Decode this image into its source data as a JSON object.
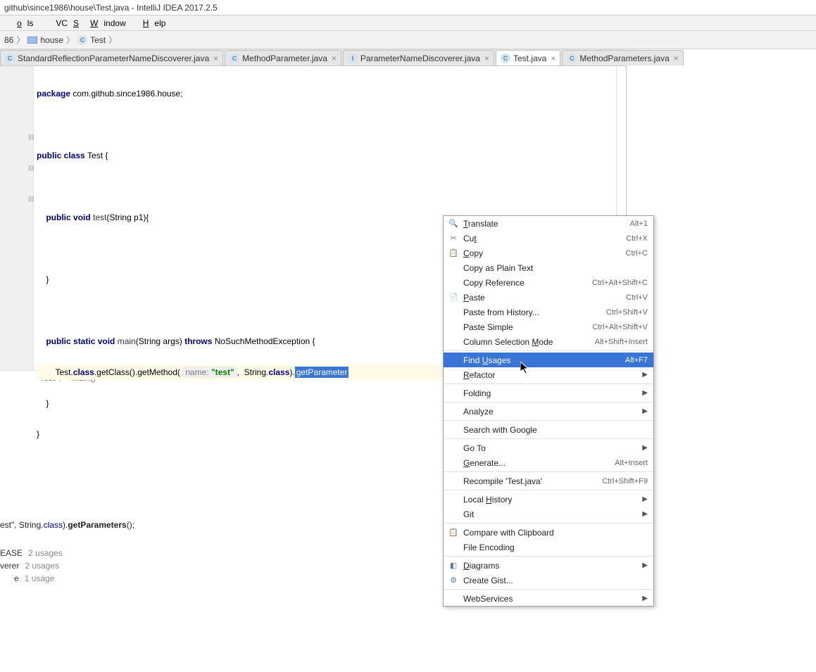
{
  "title": "github\\since1986\\house\\Test.java - IntelliJ IDEA 2017.2.5",
  "menubar": {
    "tools_pre": "",
    "tools_u": "o",
    "tools_post": "ls",
    "vcs_pre": "VC",
    "vcs_u": "S",
    "vcs_post": "",
    "window_u": "W",
    "window_post": "indow",
    "help_u": "H",
    "help_post": "elp"
  },
  "breadcrumb": {
    "b0": "86",
    "b1": "house",
    "b2": "Test"
  },
  "tabs": [
    {
      "icon": "C",
      "label": "StandardReflectionParameterNameDiscoverer.java"
    },
    {
      "icon": "C",
      "label": "MethodParameter.java"
    },
    {
      "icon": "I",
      "label": "ParameterNameDiscoverer.java"
    },
    {
      "icon": "C",
      "label": "Test.java",
      "active": true
    },
    {
      "icon": "C",
      "label": "MethodParameters.java"
    }
  ],
  "code": {
    "package_kw": "package ",
    "package": "com.github.since1986.house",
    "public": "public ",
    "class_kw": "class ",
    "class_name": "Test ",
    "static": "static ",
    "void": "void ",
    "test_name": "test",
    "test_params": "(String p1){",
    "main_name": "main",
    "main_params": "(String args) ",
    "throws": "throws ",
    "exc": "NoSuchMethodException {",
    "line_call_pre": "Test.",
    "class_ref": "class",
    "gc": ".getClass().getMethod( ",
    "name_hint": "name:",
    "test_str": "\"test\"",
    ", ": ", ",
    "String": "String.",
    "class_ref2": "class",
    "tail": "). ",
    "sel": "getParameter"
  },
  "status_path": {
    "a": "Test",
    "b": "main()"
  },
  "context_menu": [
    {
      "label_u": "T",
      "label": "ranslate",
      "shortcut": "Alt+1",
      "icon": "🔍"
    },
    {
      "label": "Cu",
      "label_u": "t",
      "label2": "",
      "shortcut": "Ctrl+X",
      "icon": "✂"
    },
    {
      "label_u": "C",
      "label": "opy",
      "shortcut": "Ctrl+C",
      "icon": "📋"
    },
    {
      "label": "Copy as Plain Text",
      "plain": true
    },
    {
      "label": "Copy Reference",
      "shortcut": "Ctrl+Alt+Shift+C",
      "plain": true
    },
    {
      "label_u": "P",
      "label": "aste",
      "shortcut": "Ctrl+V",
      "icon": "📄"
    },
    {
      "label": "Paste from History...",
      "shortcut": "Ctrl+Shift+V",
      "plain": true
    },
    {
      "label": "Paste Simple",
      "shortcut": "Ctrl+Alt+Shift+V",
      "plain": true
    },
    {
      "label": "Column Selection ",
      "label_u": "M",
      "label2": "ode",
      "shortcut": "Alt+Shift+Insert"
    },
    {
      "sep": true
    },
    {
      "label": "Find ",
      "label_u": "U",
      "label2": "sages",
      "shortcut": "Alt+F7",
      "highlight": true
    },
    {
      "label_u": "R",
      "label": "efactor",
      "submenu": true
    },
    {
      "sep": true
    },
    {
      "label": "Folding",
      "submenu": true,
      "plain": true
    },
    {
      "sep": true
    },
    {
      "label": "Analyze",
      "submenu": true,
      "plain": true
    },
    {
      "sep": true
    },
    {
      "label": "Search with Google",
      "plain": true
    },
    {
      "sep": true
    },
    {
      "label": "Go To",
      "submenu": true,
      "plain": true
    },
    {
      "label_u": "G",
      "label": "enerate...",
      "shortcut": "Alt+Insert"
    },
    {
      "sep": true
    },
    {
      "label": "Recompile 'Test.java'",
      "shortcut": "Ctrl+Shift+F9",
      "plain": true
    },
    {
      "sep": true
    },
    {
      "label": "Local ",
      "label_u": "H",
      "label2": "istory",
      "submenu": true
    },
    {
      "label": "Git",
      "submenu": true,
      "plain": true
    },
    {
      "sep": true
    },
    {
      "label": "Compare with Clipboard",
      "plain": true,
      "icon": "📋"
    },
    {
      "label": "File Encoding",
      "plain": true
    },
    {
      "sep": true
    },
    {
      "label_u": "D",
      "label": "iagrams",
      "submenu": true,
      "icon": "◧"
    },
    {
      "label": "Create Gist...",
      "plain": true,
      "icon": "⚙"
    },
    {
      "sep": true
    },
    {
      "label": "WebServices",
      "submenu": true,
      "plain": true
    }
  ],
  "bottom": {
    "code_pre": "est\", String.",
    "code_kw": "class",
    "code_post": ").",
    "code_bold": "getParameters",
    "code_tail": "();",
    "rows": [
      {
        "label": "EASE",
        "count": "2 usages"
      },
      {
        "label": "verer",
        "count": "2 usages"
      },
      {
        "label": "e",
        "count": "1 usage",
        "indent": true
      }
    ]
  }
}
